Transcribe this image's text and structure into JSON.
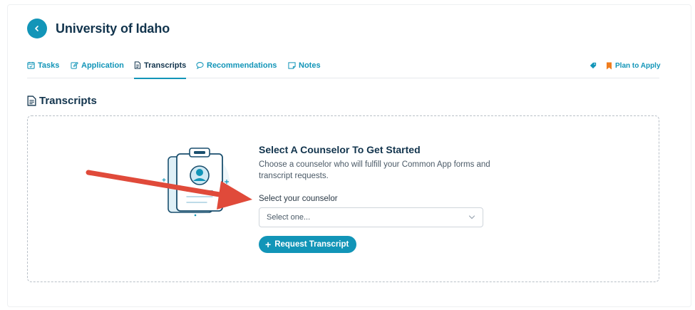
{
  "header": {
    "title": "University of Idaho",
    "back_icon": "chevron-left-icon"
  },
  "tabs": [
    {
      "label": "Tasks",
      "icon": "calendar-check-icon"
    },
    {
      "label": "Application",
      "icon": "edit-icon"
    },
    {
      "label": "Transcripts",
      "icon": "file-text-icon",
      "active": true
    },
    {
      "label": "Recommendations",
      "icon": "speech-bubble-icon"
    },
    {
      "label": "Notes",
      "icon": "note-icon"
    }
  ],
  "actions": {
    "tag_icon": "tag-icon",
    "plan_label": "Plan to Apply",
    "plan_icon": "bookmark-icon",
    "plan_color": "#f07d1e"
  },
  "section": {
    "title": "Transcripts",
    "icon": "file-text-icon"
  },
  "panel": {
    "heading": "Select A Counselor To Get Started",
    "description": "Choose a counselor who will fulfill your Common App forms and transcript requests.",
    "select_label": "Select your counselor",
    "select_value": "Select one...",
    "button_label": "Request Transcript"
  },
  "colors": {
    "accent": "#1295b8",
    "title": "#12344d",
    "annotation_arrow": "#e04a3a"
  }
}
